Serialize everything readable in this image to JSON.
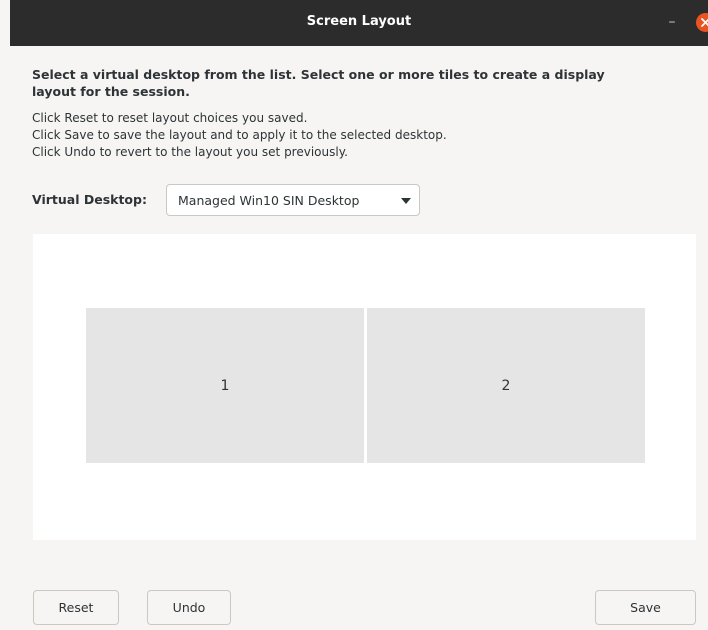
{
  "window": {
    "title": "Screen Layout",
    "minimize_glyph": "–"
  },
  "instructions": {
    "heading": "Select a virtual desktop from the list. Select one or more tiles to create a display layout for the session.",
    "line1": "Click Reset to reset layout choices you saved.",
    "line2": "Click Save to save the layout and to apply it to the selected desktop.",
    "line3": "Click Undo to revert to the layout you set previously."
  },
  "virtual_desktop": {
    "label": "Virtual Desktop:",
    "selected": "Managed Win10 SIN Desktop"
  },
  "tiles": [
    {
      "label": "1"
    },
    {
      "label": "2"
    }
  ],
  "buttons": {
    "reset": "Reset",
    "undo": "Undo",
    "save": "Save"
  },
  "colors": {
    "titlebar": "#2c2c2c",
    "close_button": "#e95420",
    "tile": "#e5e5e5",
    "background": "#f6f5f4"
  },
  "icons": {
    "close": "close-icon",
    "minimize": "minimize-icon",
    "dropdown": "chevron-down-icon"
  }
}
